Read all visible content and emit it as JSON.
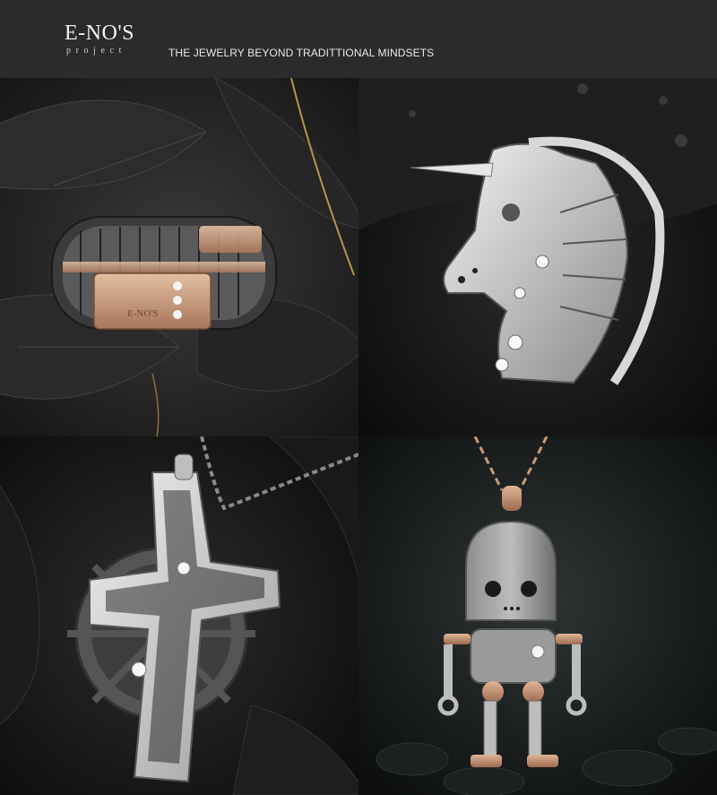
{
  "header": {
    "logo_main": "E-NO'S",
    "logo_sub": "project",
    "tagline": "THE JEWELRY BEYOND TRADITTIONAL MINDSETS",
    "background": "#2b2b2b"
  },
  "gallery": {
    "items": [
      {
        "name": "chain-ring",
        "engraving": "E-NO'S"
      },
      {
        "name": "unicorn-brooch"
      },
      {
        "name": "gear-cross-pendant"
      },
      {
        "name": "robot-pendant"
      }
    ]
  },
  "colors": {
    "rose_gold": "#c99a7a",
    "silver": "#c8c8c8",
    "dark_leaf": "#2a2a2a"
  }
}
